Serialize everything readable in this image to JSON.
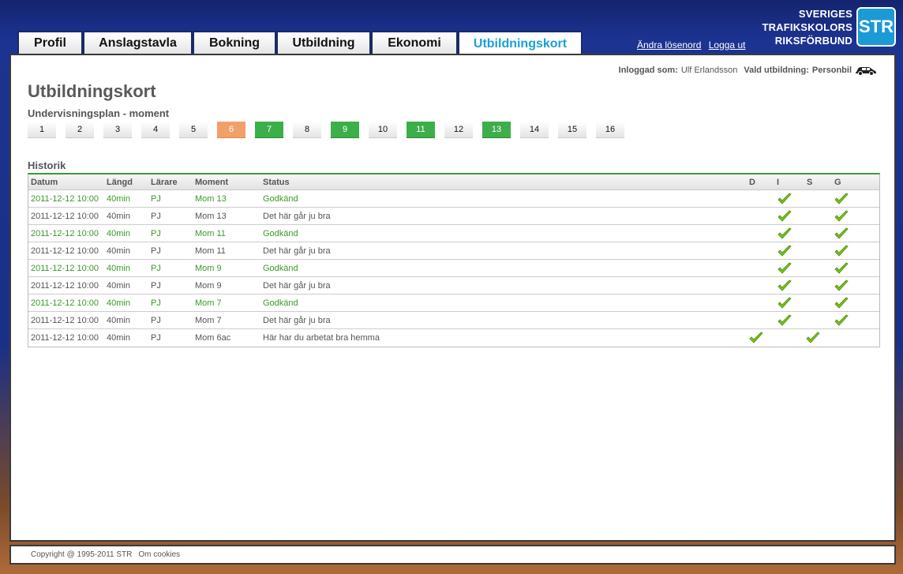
{
  "nav": {
    "tabs": [
      {
        "label": "Profil",
        "active": false
      },
      {
        "label": "Anslagstavla",
        "active": false
      },
      {
        "label": "Bokning",
        "active": false
      },
      {
        "label": "Utbildning",
        "active": false
      },
      {
        "label": "Ekonomi",
        "active": false
      },
      {
        "label": "Utbildningskort",
        "active": true
      }
    ]
  },
  "toplinks": {
    "change_password": "Ändra lösenord",
    "logout": "Logga ut"
  },
  "brand": {
    "line1": "SVERIGES",
    "line2": "TRAFIKSKOLORS",
    "line3": "RIKSFÖRBUND",
    "logo": "STR"
  },
  "login": {
    "label": "Inloggad som:",
    "user": "Ulf Erlandsson",
    "education_label": "Vald utbildning:",
    "education": "Personbil",
    "icon": "car-icon"
  },
  "page": {
    "title": "Utbildningskort",
    "subtitle": "Undervisningsplan - moment",
    "history_title": "Historik"
  },
  "moments": [
    {
      "n": "1",
      "status": "none"
    },
    {
      "n": "2",
      "status": "none"
    },
    {
      "n": "3",
      "status": "none"
    },
    {
      "n": "4",
      "status": "none"
    },
    {
      "n": "5",
      "status": "none"
    },
    {
      "n": "6",
      "status": "partial"
    },
    {
      "n": "7",
      "status": "done"
    },
    {
      "n": "8",
      "status": "none"
    },
    {
      "n": "9",
      "status": "done"
    },
    {
      "n": "10",
      "status": "none"
    },
    {
      "n": "11",
      "status": "done"
    },
    {
      "n": "12",
      "status": "none"
    },
    {
      "n": "13",
      "status": "done"
    },
    {
      "n": "14",
      "status": "none"
    },
    {
      "n": "15",
      "status": "none"
    },
    {
      "n": "16",
      "status": "none"
    }
  ],
  "history": {
    "headers": {
      "date": "Datum",
      "length": "Längd",
      "teacher": "Lärare",
      "moment": "Moment",
      "status": "Status",
      "d": "D",
      "i": "I",
      "s": "S",
      "g": "G"
    },
    "rows": [
      {
        "date": "2011-12-12 10:00",
        "length": "40min",
        "teacher": "PJ",
        "moment": "Mom 13",
        "status": "Godkänd",
        "approved": true,
        "d": false,
        "i": true,
        "s": false,
        "g": true
      },
      {
        "date": "2011-12-12 10:00",
        "length": "40min",
        "teacher": "PJ",
        "moment": "Mom 13",
        "status": "Det här går ju bra",
        "approved": false,
        "d": false,
        "i": true,
        "s": false,
        "g": true
      },
      {
        "date": "2011-12-12 10:00",
        "length": "40min",
        "teacher": "PJ",
        "moment": "Mom 11",
        "status": "Godkänd",
        "approved": true,
        "d": false,
        "i": true,
        "s": false,
        "g": true
      },
      {
        "date": "2011-12-12 10:00",
        "length": "40min",
        "teacher": "PJ",
        "moment": "Mom 11",
        "status": "Det här går ju bra",
        "approved": false,
        "d": false,
        "i": true,
        "s": false,
        "g": true
      },
      {
        "date": "2011-12-12 10:00",
        "length": "40min",
        "teacher": "PJ",
        "moment": "Mom 9",
        "status": "Godkänd",
        "approved": true,
        "d": false,
        "i": true,
        "s": false,
        "g": true
      },
      {
        "date": "2011-12-12 10:00",
        "length": "40min",
        "teacher": "PJ",
        "moment": "Mom 9",
        "status": "Det här går ju bra",
        "approved": false,
        "d": false,
        "i": true,
        "s": false,
        "g": true
      },
      {
        "date": "2011-12-12 10:00",
        "length": "40min",
        "teacher": "PJ",
        "moment": "Mom 7",
        "status": "Godkänd",
        "approved": true,
        "d": false,
        "i": true,
        "s": false,
        "g": true
      },
      {
        "date": "2011-12-12 10:00",
        "length": "40min",
        "teacher": "PJ",
        "moment": "Mom 7",
        "status": "Det här går ju bra",
        "approved": false,
        "d": false,
        "i": true,
        "s": false,
        "g": true
      },
      {
        "date": "2011-12-12 10:00",
        "length": "40min",
        "teacher": "PJ",
        "moment": "Mom 6ac",
        "status": "Här har du arbetat bra hemma",
        "approved": false,
        "d": true,
        "i": false,
        "s": true,
        "g": false
      }
    ]
  },
  "footer": {
    "copyright": "Copyright @ 1995-2011 STR",
    "cookies": "Om cookies"
  },
  "colors": {
    "accent": "#1aa0d8",
    "green": "#3cae4a",
    "orange": "#f2a06a",
    "text_green": "#3a9a2a",
    "check": "#7ac41a"
  }
}
